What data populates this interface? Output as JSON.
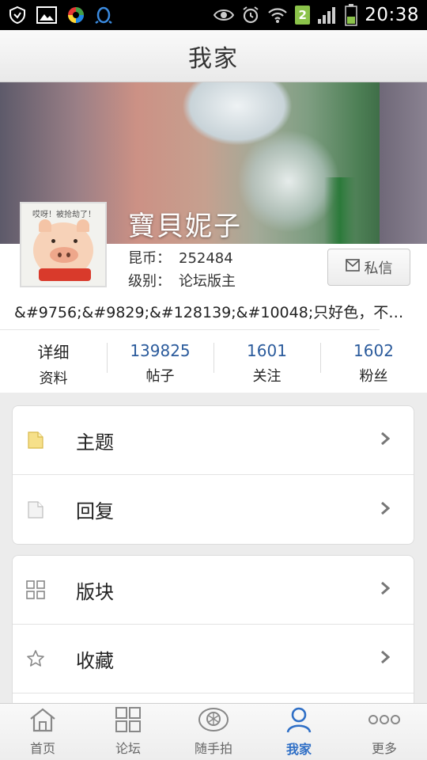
{
  "status_bar": {
    "time": "20:38",
    "sim_badge": "2",
    "left_icons": [
      "shield-icon",
      "image-icon",
      "app-ring-icon",
      "qq-penguin-icon"
    ],
    "right_icons": [
      "eye-icon",
      "alarm-icon",
      "wifi-icon",
      "signal-icon",
      "battery-icon"
    ]
  },
  "header": {
    "title": "我家"
  },
  "profile": {
    "username": "寶貝妮子",
    "avatar_caption": "哎呀！被抢劫了！",
    "coins_label": "昆币：",
    "coins_value": "252484",
    "level_label": "级别：",
    "level_value": "论坛版主",
    "message_button": "私信",
    "signature": "&#9756;&#9829;&#128139;&#10048;只好色，不…"
  },
  "stats": [
    {
      "top": "详细",
      "bottom": "资料"
    },
    {
      "top": "139825",
      "bottom": "帖子"
    },
    {
      "top": "1601",
      "bottom": "关注"
    },
    {
      "top": "1602",
      "bottom": "粉丝"
    }
  ],
  "menu_group_1": [
    {
      "label": "主题",
      "icon": "folder-icon"
    },
    {
      "label": "回复",
      "icon": "document-icon"
    }
  ],
  "menu_group_2": [
    {
      "label": "版块",
      "icon": "grid-icon"
    },
    {
      "label": "收藏",
      "icon": "star-icon"
    }
  ],
  "bottom_nav": [
    {
      "label": "首页",
      "icon": "home-icon",
      "active": false
    },
    {
      "label": "论坛",
      "icon": "forum-grid-icon",
      "active": false
    },
    {
      "label": "随手拍",
      "icon": "camera-shutter-icon",
      "active": false
    },
    {
      "label": "我家",
      "icon": "person-icon",
      "active": true
    },
    {
      "label": "更多",
      "icon": "more-dots-icon",
      "active": false
    }
  ],
  "colors": {
    "accent": "#2f6fc6",
    "stat_number": "#2b5b9c"
  }
}
